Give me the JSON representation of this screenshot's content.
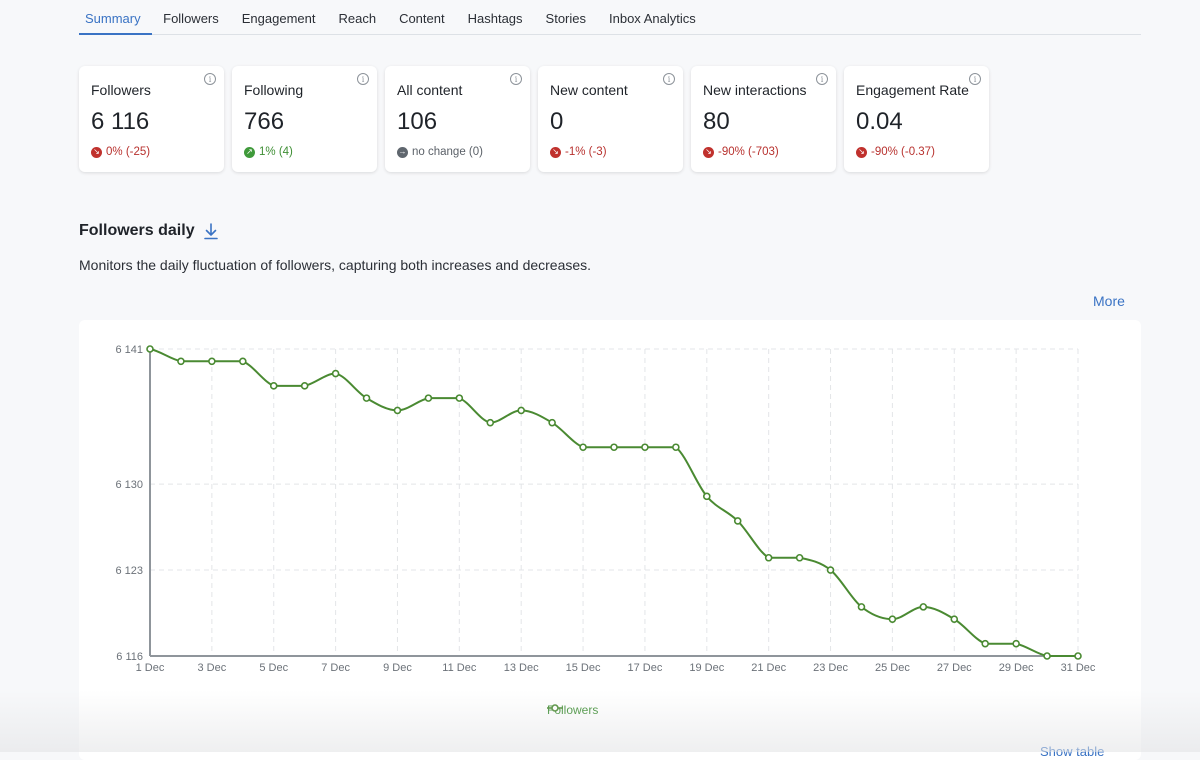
{
  "tabs": [
    {
      "label": "Summary",
      "active": true
    },
    {
      "label": "Followers",
      "active": false
    },
    {
      "label": "Engagement",
      "active": false
    },
    {
      "label": "Reach",
      "active": false
    },
    {
      "label": "Content",
      "active": false
    },
    {
      "label": "Hashtags",
      "active": false
    },
    {
      "label": "Stories",
      "active": false
    },
    {
      "label": "Inbox Analytics",
      "active": false
    }
  ],
  "cards": [
    {
      "title": "Followers",
      "value": "6 116",
      "trend": "down",
      "delta": "0% (-25)",
      "icon": "arrow-down-right-icon"
    },
    {
      "title": "Following",
      "value": "766",
      "trend": "up",
      "delta": "1% (4)",
      "icon": "arrow-up-right-icon"
    },
    {
      "title": "All content",
      "value": "106",
      "trend": "flat",
      "delta": "no change (0)",
      "icon": "arrow-right-icon"
    },
    {
      "title": "New content",
      "value": "0",
      "trend": "down",
      "delta": "-1% (-3)",
      "icon": "arrow-down-right-icon"
    },
    {
      "title": "New interactions",
      "value": "80",
      "trend": "down",
      "delta": "-90% (-703)",
      "icon": "arrow-down-right-icon"
    },
    {
      "title": "Engagement Rate",
      "value": "0.04",
      "trend": "down",
      "delta": "-90% (-0.37)",
      "icon": "arrow-down-right-icon"
    }
  ],
  "section": {
    "title": "Followers daily",
    "description": "Monitors the daily fluctuation of followers, capturing both increases and decreases.",
    "more_label": "More",
    "show_table_label": "Show table"
  },
  "colors": {
    "accent": "#3a73c4",
    "series": "#4a8a32",
    "negative": "#c0312d",
    "positive": "#3f9a3a",
    "neutral": "#5f666e"
  },
  "chart_data": {
    "type": "line",
    "title": "Followers daily",
    "xlabel": "",
    "ylabel": "",
    "x": [
      "1 Dec",
      "2 Dec",
      "3 Dec",
      "4 Dec",
      "5 Dec",
      "6 Dec",
      "7 Dec",
      "8 Dec",
      "9 Dec",
      "10 Dec",
      "11 Dec",
      "12 Dec",
      "13 Dec",
      "14 Dec",
      "15 Dec",
      "16 Dec",
      "17 Dec",
      "18 Dec",
      "19 Dec",
      "20 Dec",
      "21 Dec",
      "22 Dec",
      "23 Dec",
      "24 Dec",
      "25 Dec",
      "26 Dec",
      "27 Dec",
      "28 Dec",
      "29 Dec",
      "30 Dec",
      "31 Dec"
    ],
    "x_tick_labels": [
      "1 Dec",
      "3 Dec",
      "5 Dec",
      "7 Dec",
      "9 Dec",
      "11 Dec",
      "13 Dec",
      "15 Dec",
      "17 Dec",
      "19 Dec",
      "21 Dec",
      "23 Dec",
      "25 Dec",
      "27 Dec",
      "29 Dec",
      "31 Dec"
    ],
    "y_ticks": [
      6116,
      6123,
      6130,
      6141
    ],
    "y_tick_labels": [
      "6 116",
      "6 123",
      "6 130",
      "6 141"
    ],
    "ylim": [
      6116,
      6141
    ],
    "grid": true,
    "legend_position": "bottom-center",
    "series": [
      {
        "name": "Followers",
        "values": [
          6141,
          6140,
          6140,
          6140,
          6138,
          6138,
          6139,
          6137,
          6136,
          6137,
          6137,
          6135,
          6136,
          6135,
          6133,
          6133,
          6133,
          6133,
          6129,
          6127,
          6124,
          6124,
          6123,
          6120,
          6119,
          6120,
          6119,
          6117,
          6117,
          6116,
          6116
        ]
      }
    ]
  }
}
